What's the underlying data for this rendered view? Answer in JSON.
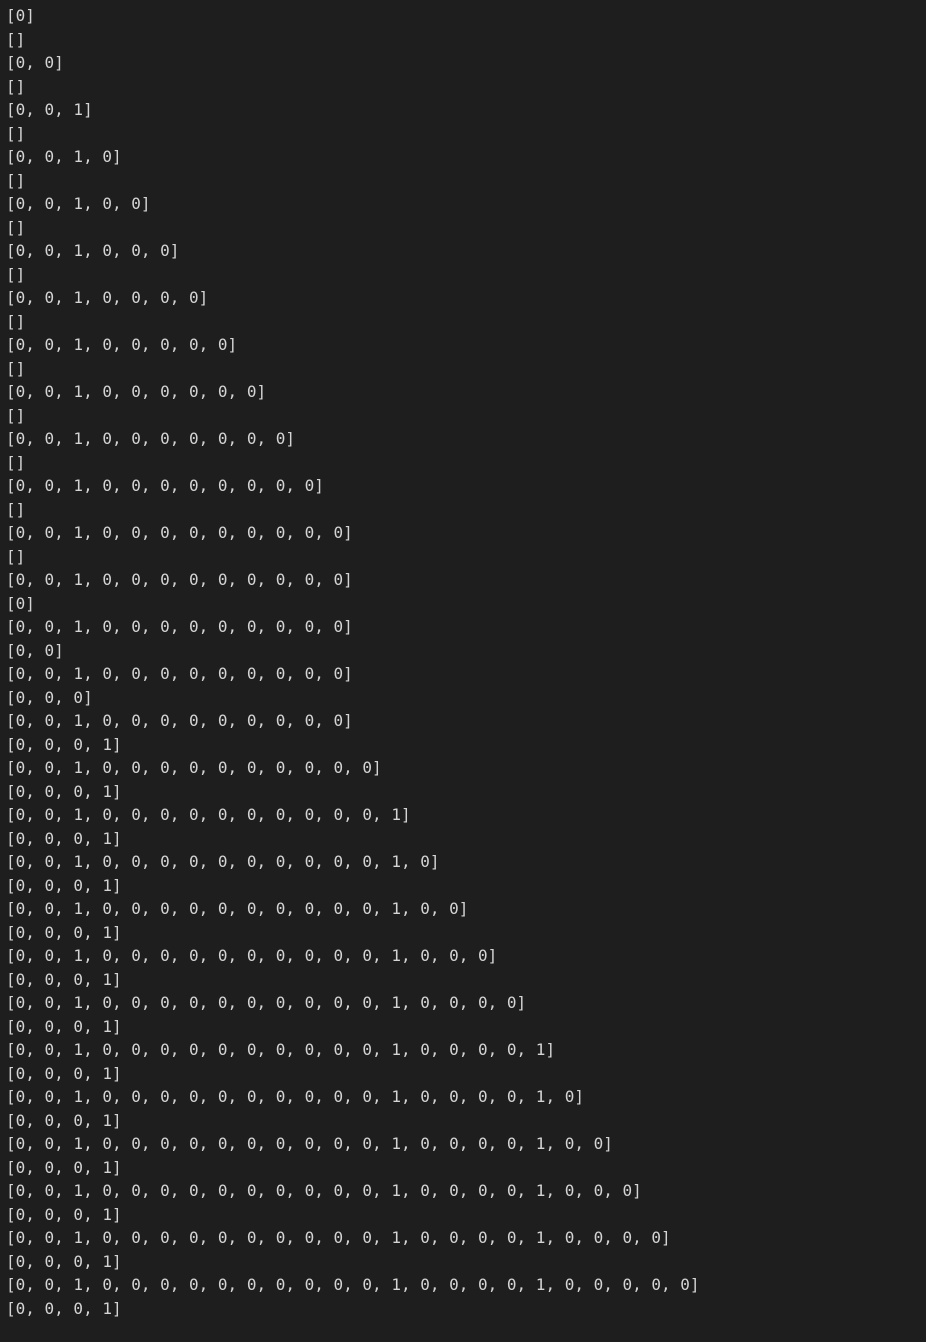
{
  "lines": [
    "[0]",
    "[]",
    "[0, 0]",
    "[]",
    "[0, 0, 1]",
    "[]",
    "[0, 0, 1, 0]",
    "[]",
    "[0, 0, 1, 0, 0]",
    "[]",
    "[0, 0, 1, 0, 0, 0]",
    "[]",
    "[0, 0, 1, 0, 0, 0, 0]",
    "[]",
    "[0, 0, 1, 0, 0, 0, 0, 0]",
    "[]",
    "[0, 0, 1, 0, 0, 0, 0, 0, 0]",
    "[]",
    "[0, 0, 1, 0, 0, 0, 0, 0, 0, 0]",
    "[]",
    "[0, 0, 1, 0, 0, 0, 0, 0, 0, 0, 0]",
    "[]",
    "[0, 0, 1, 0, 0, 0, 0, 0, 0, 0, 0, 0]",
    "[]",
    "[0, 0, 1, 0, 0, 0, 0, 0, 0, 0, 0, 0]",
    "[0]",
    "[0, 0, 1, 0, 0, 0, 0, 0, 0, 0, 0, 0]",
    "[0, 0]",
    "[0, 0, 1, 0, 0, 0, 0, 0, 0, 0, 0, 0]",
    "[0, 0, 0]",
    "[0, 0, 1, 0, 0, 0, 0, 0, 0, 0, 0, 0]",
    "[0, 0, 0, 1]",
    "[0, 0, 1, 0, 0, 0, 0, 0, 0, 0, 0, 0, 0]",
    "[0, 0, 0, 1]",
    "[0, 0, 1, 0, 0, 0, 0, 0, 0, 0, 0, 0, 0, 1]",
    "[0, 0, 0, 1]",
    "[0, 0, 1, 0, 0, 0, 0, 0, 0, 0, 0, 0, 0, 1, 0]",
    "[0, 0, 0, 1]",
    "[0, 0, 1, 0, 0, 0, 0, 0, 0, 0, 0, 0, 0, 1, 0, 0]",
    "[0, 0, 0, 1]",
    "[0, 0, 1, 0, 0, 0, 0, 0, 0, 0, 0, 0, 0, 1, 0, 0, 0]",
    "[0, 0, 0, 1]",
    "[0, 0, 1, 0, 0, 0, 0, 0, 0, 0, 0, 0, 0, 1, 0, 0, 0, 0]",
    "[0, 0, 0, 1]",
    "[0, 0, 1, 0, 0, 0, 0, 0, 0, 0, 0, 0, 0, 1, 0, 0, 0, 0, 1]",
    "[0, 0, 0, 1]",
    "[0, 0, 1, 0, 0, 0, 0, 0, 0, 0, 0, 0, 0, 1, 0, 0, 0, 0, 1, 0]",
    "[0, 0, 0, 1]",
    "[0, 0, 1, 0, 0, 0, 0, 0, 0, 0, 0, 0, 0, 1, 0, 0, 0, 0, 1, 0, 0]",
    "[0, 0, 0, 1]",
    "[0, 0, 1, 0, 0, 0, 0, 0, 0, 0, 0, 0, 0, 1, 0, 0, 0, 0, 1, 0, 0, 0]",
    "[0, 0, 0, 1]",
    "[0, 0, 1, 0, 0, 0, 0, 0, 0, 0, 0, 0, 0, 1, 0, 0, 0, 0, 1, 0, 0, 0, 0]",
    "[0, 0, 0, 1]",
    "[0, 0, 1, 0, 0, 0, 0, 0, 0, 0, 0, 0, 0, 1, 0, 0, 0, 0, 1, 0, 0, 0, 0, 0]",
    "[0, 0, 0, 1]"
  ]
}
